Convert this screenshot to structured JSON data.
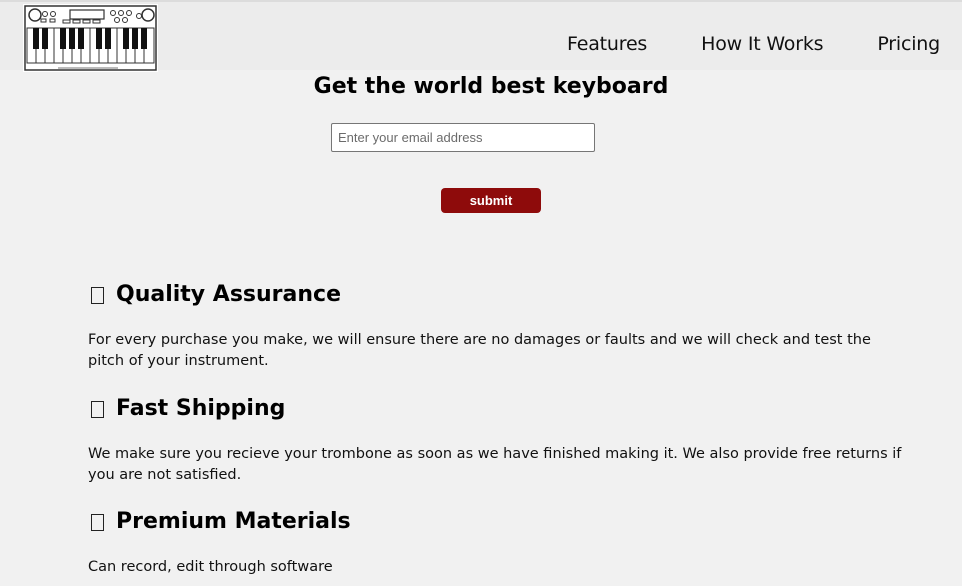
{
  "header": {
    "logo_alt": "keyboard logo",
    "nav": [
      {
        "label": "Features"
      },
      {
        "label": "How It Works"
      },
      {
        "label": "Pricing"
      }
    ]
  },
  "hero": {
    "title": "Get the world best keyboard",
    "email_placeholder": "Enter your email address",
    "submit_label": "submit"
  },
  "features": [
    {
      "icon": "missing-glyph-icon",
      "title": "Quality Assurance",
      "text": "For every purchase you make, we will ensure there are no damages or faults and we will check and test the pitch of your instrument."
    },
    {
      "icon": "missing-glyph-icon",
      "title": "Fast Shipping",
      "text": "We make sure you recieve your trombone as soon as we have finished making it. We also provide free returns if you are not satisfied."
    },
    {
      "icon": "missing-glyph-icon",
      "title": "Premium Materials",
      "text": "Can record, edit through software"
    }
  ],
  "colors": {
    "background": "#f1f1f1",
    "header_background": "#ececec",
    "submit_button": "#8e0b0b"
  }
}
